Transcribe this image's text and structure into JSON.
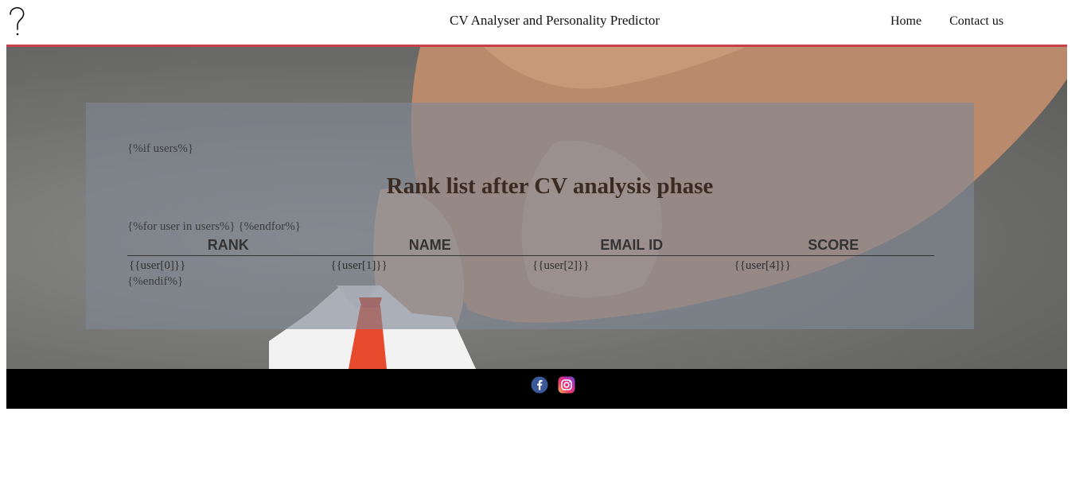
{
  "header": {
    "title": "CV Analyser and Personality Predictor",
    "logo_icon": "question-mark-logo-icon",
    "nav": [
      {
        "label": "Home"
      },
      {
        "label": "Contact us"
      }
    ],
    "rule_color": "#c8404a"
  },
  "hero": {
    "background": "hand-holding-origami-shirt-tie-photo",
    "template_if": "{%if users%}",
    "heading": "Rank list after CV analysis phase",
    "template_for": "{%for user in users%} {%endfor%}",
    "template_endif": "{%endif%}",
    "table": {
      "columns": [
        "RANK",
        "NAME",
        "EMAIL ID",
        "SCORE"
      ],
      "rows": [
        [
          "{{user[0]}}",
          "{{user[1]}}",
          "{{user[2]}}",
          "{{user[4]}}"
        ]
      ]
    }
  },
  "footer": {
    "icons": [
      "facebook-icon",
      "instagram-icon"
    ],
    "background": "#000000"
  }
}
